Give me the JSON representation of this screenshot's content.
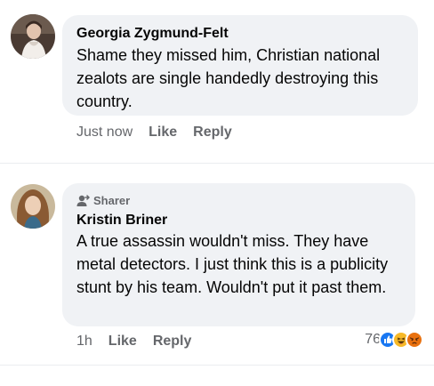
{
  "comments": [
    {
      "author": "Georgia Zygmund-Felt",
      "text": "Shame they missed him, Christian national zealots are single handedly destroying this country.",
      "time": "Just now",
      "like_label": "Like",
      "reply_label": "Reply"
    },
    {
      "badge": "Sharer",
      "author": "Kristin Briner",
      "text": "A true assassin wouldn't miss. They have metal detectors. I just think this is a publicity stunt by his team. Wouldn't put it past them.",
      "time": "1h",
      "like_label": "Like",
      "reply_label": "Reply",
      "reaction_count": "76",
      "reactions": [
        "like-icon",
        "haha-icon",
        "angry-icon"
      ]
    }
  ],
  "colors": {
    "bubble": "#f0f2f5",
    "secondary_text": "#65676b",
    "like_blue": "#1877f2",
    "haha_yellow": "#f7b928",
    "angry_orange": "#e9710f"
  }
}
